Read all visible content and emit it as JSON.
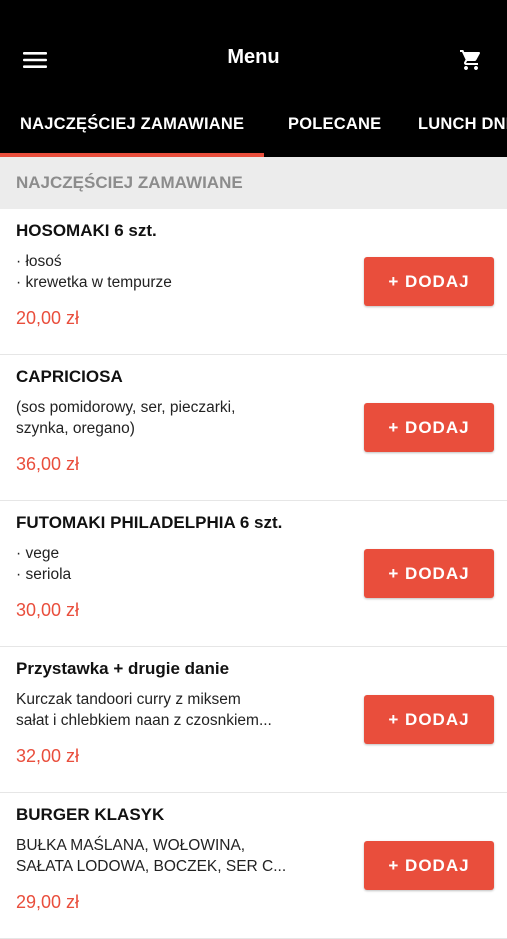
{
  "header": {
    "title": "Menu",
    "menu_icon": "hamburger-menu-icon",
    "cart_icon": "shopping-cart-icon"
  },
  "tabs": [
    {
      "label": "NAJCZĘŚCIEJ ZAMAWIANE",
      "active": true
    },
    {
      "label": "POLECANE",
      "active": false
    },
    {
      "label": "LUNCH DNIA",
      "active": false
    }
  ],
  "section": {
    "title": "NAJCZĘŚCIEJ ZAMAWIANE"
  },
  "items": [
    {
      "name": "HOSOMAKI 6 szt.",
      "desc": [
        "· łosoś",
        "· krewetka w tempurze"
      ],
      "price": "20,00 zł",
      "button": "+ DODAJ"
    },
    {
      "name": "CAPRICIOSA",
      "desc": [
        "(sos pomidorowy, ser, pieczarki,",
        "szynka, oregano)"
      ],
      "price": "36,00 zł",
      "button": "+ DODAJ"
    },
    {
      "name": "FUTOMAKI PHILADELPHIA 6 szt.",
      "desc": [
        "· vege",
        "· seriola"
      ],
      "price": "30,00 zł",
      "button": "+ DODAJ"
    },
    {
      "name": "Przystawka + drugie danie",
      "desc": [
        "Kurczak tandoori curry z miksem",
        "sałat i chlebkiem naan z czosnkiem..."
      ],
      "price": "32,00 zł",
      "button": "+ DODAJ"
    },
    {
      "name": "BURGER KLASYK",
      "desc": [
        "BUŁKA MAŚLANA, WOŁOWINA,",
        "SAŁATA LODOWA, BOCZEK, SER C..."
      ],
      "price": "29,00 zł",
      "button": "+ DODAJ"
    }
  ],
  "colors": {
    "accent": "#e94e3c",
    "topbar": "#000000",
    "section_bg": "#ececec"
  }
}
